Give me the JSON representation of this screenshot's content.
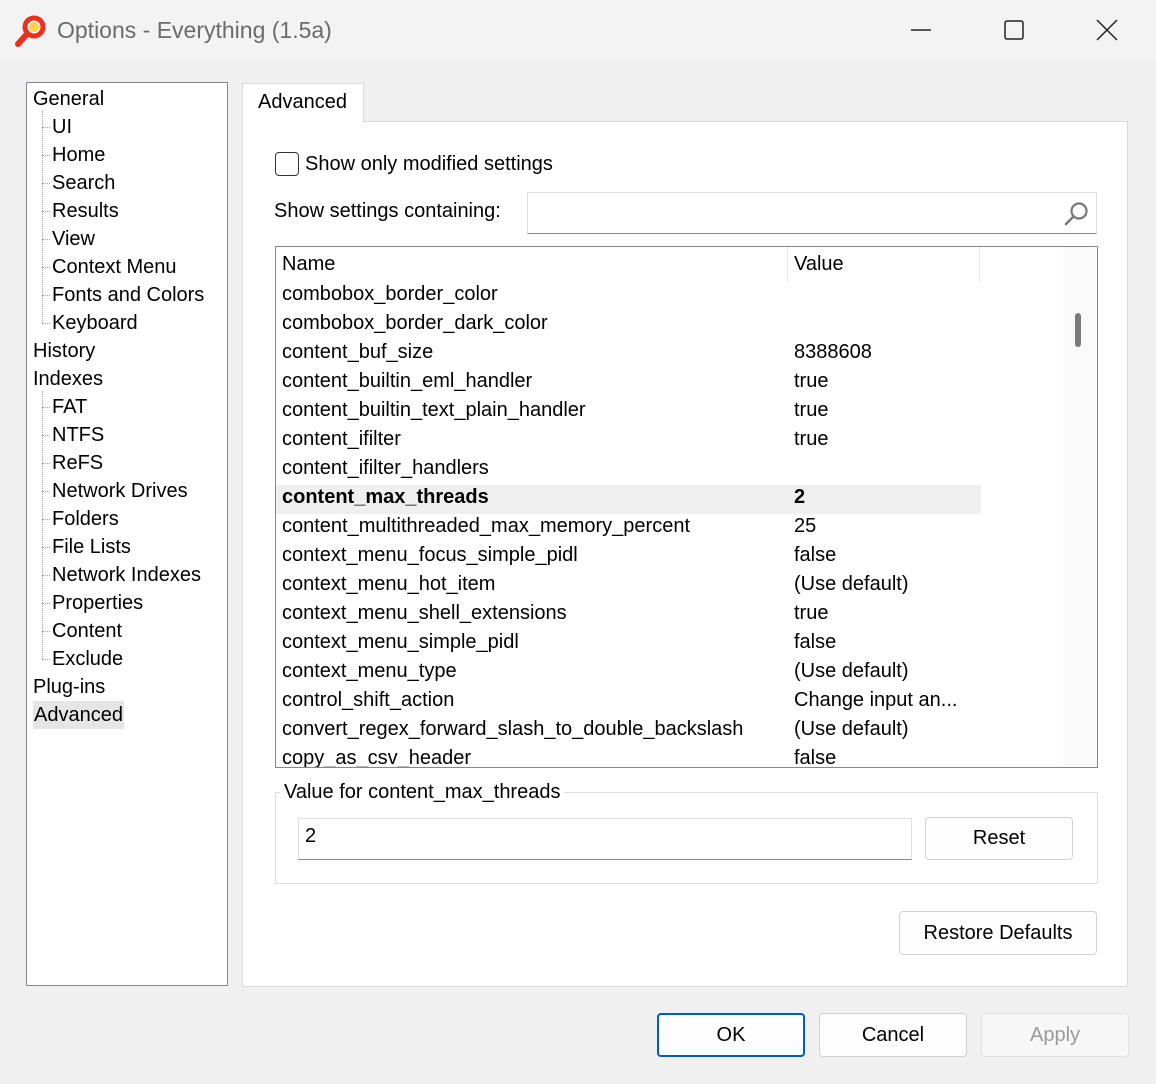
{
  "window": {
    "title": "Options - Everything (1.5a)",
    "icons": {
      "app": "magnifier-app-icon",
      "minimize": "minimize-icon",
      "maximize": "maximize-icon",
      "close": "close-icon"
    }
  },
  "tree": [
    {
      "label": "General",
      "level": 0
    },
    {
      "label": "UI",
      "level": 1
    },
    {
      "label": "Home",
      "level": 1
    },
    {
      "label": "Search",
      "level": 1
    },
    {
      "label": "Results",
      "level": 1
    },
    {
      "label": "View",
      "level": 1
    },
    {
      "label": "Context Menu",
      "level": 1
    },
    {
      "label": "Fonts and Colors",
      "level": 1
    },
    {
      "label": "Keyboard",
      "level": 1
    },
    {
      "label": "History",
      "level": 0
    },
    {
      "label": "Indexes",
      "level": 0
    },
    {
      "label": "FAT",
      "level": 1
    },
    {
      "label": "NTFS",
      "level": 1
    },
    {
      "label": "ReFS",
      "level": 1
    },
    {
      "label": "Network Drives",
      "level": 1
    },
    {
      "label": "Folders",
      "level": 1
    },
    {
      "label": "File Lists",
      "level": 1
    },
    {
      "label": "Network Indexes",
      "level": 1
    },
    {
      "label": "Properties",
      "level": 1
    },
    {
      "label": "Content",
      "level": 1
    },
    {
      "label": "Exclude",
      "level": 1
    },
    {
      "label": "Plug-ins",
      "level": 0
    },
    {
      "label": "Advanced",
      "level": 0,
      "selected": true
    }
  ],
  "tab": {
    "label": "Advanced"
  },
  "filters": {
    "show_modified_label": "Show only modified settings",
    "show_modified_checked": false,
    "containing_label": "Show settings containing:",
    "containing_value": ""
  },
  "list": {
    "columns": [
      "Name",
      "Value"
    ],
    "rows": [
      {
        "name": "combobox_border_color",
        "value": ""
      },
      {
        "name": "combobox_border_dark_color",
        "value": ""
      },
      {
        "name": "content_buf_size",
        "value": "8388608"
      },
      {
        "name": "content_builtin_eml_handler",
        "value": "true"
      },
      {
        "name": "content_builtin_text_plain_handler",
        "value": "true"
      },
      {
        "name": "content_ifilter",
        "value": "true"
      },
      {
        "name": "content_ifilter_handlers",
        "value": ""
      },
      {
        "name": "content_max_threads",
        "value": "2",
        "selected": true
      },
      {
        "name": "content_multithreaded_max_memory_percent",
        "value": "25"
      },
      {
        "name": "context_menu_focus_simple_pidl",
        "value": "false"
      },
      {
        "name": "context_menu_hot_item",
        "value": "(Use default)"
      },
      {
        "name": "context_menu_shell_extensions",
        "value": "true"
      },
      {
        "name": "context_menu_simple_pidl",
        "value": "false"
      },
      {
        "name": "context_menu_type",
        "value": "(Use default)"
      },
      {
        "name": "control_shift_action",
        "value": "Change input an..."
      },
      {
        "name": "convert_regex_forward_slash_to_double_backslash",
        "value": "(Use default)"
      },
      {
        "name": "copy_as_csv_header",
        "value": "false"
      }
    ]
  },
  "value_group": {
    "label": "Value for content_max_threads",
    "value": "2",
    "reset_label": "Reset"
  },
  "buttons": {
    "restore_defaults": "Restore Defaults",
    "ok": "OK",
    "cancel": "Cancel",
    "apply": "Apply"
  },
  "colors": {
    "accent": "#005fb8",
    "selected_row": "#efefef",
    "icon_red": "#e8321e"
  }
}
